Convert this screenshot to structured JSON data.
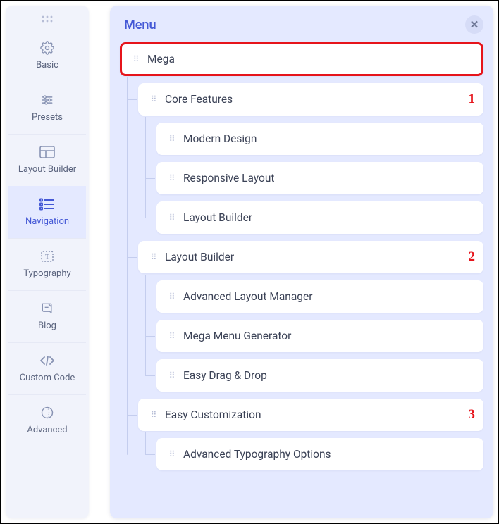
{
  "sidebar": {
    "items": [
      {
        "label": "Basic",
        "icon": "gear-icon"
      },
      {
        "label": "Presets",
        "icon": "sliders-icon"
      },
      {
        "label": "Layout Builder",
        "icon": "layout-icon"
      },
      {
        "label": "Navigation",
        "icon": "list-icon"
      },
      {
        "label": "Typography",
        "icon": "typography-icon"
      },
      {
        "label": "Blog",
        "icon": "blog-icon"
      },
      {
        "label": "Custom Code",
        "icon": "code-icon"
      },
      {
        "label": "Advanced",
        "icon": "advanced-icon"
      }
    ],
    "active_index": 3
  },
  "panel": {
    "title": "Menu",
    "highlighted_item": "Mega",
    "tree": {
      "label": "Mega",
      "children": [
        {
          "label": "Core Features",
          "badge": "1",
          "children": [
            {
              "label": "Modern Design"
            },
            {
              "label": "Responsive Layout"
            },
            {
              "label": "Layout Builder"
            }
          ]
        },
        {
          "label": "Layout Builder",
          "badge": "2",
          "children": [
            {
              "label": "Advanced Layout Manager"
            },
            {
              "label": "Mega Menu Generator"
            },
            {
              "label": "Easy Drag & Drop"
            }
          ]
        },
        {
          "label": "Easy Customization",
          "badge": "3",
          "children": [
            {
              "label": "Advanced Typography Options"
            }
          ]
        }
      ]
    }
  }
}
